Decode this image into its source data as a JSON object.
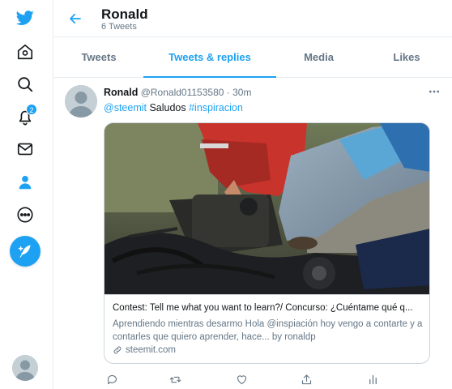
{
  "nav": {
    "notifications_badge": "2",
    "icons": [
      "twitter-logo-icon",
      "home-icon",
      "explore-icon",
      "notifications-icon",
      "messages-icon",
      "profile-icon",
      "more-icon",
      "compose-icon"
    ],
    "accent": "#1da1f2"
  },
  "header": {
    "name": "Ronald",
    "tweets_count": "6 Tweets"
  },
  "tabs": [
    {
      "label": "Tweets"
    },
    {
      "label": "Tweets & replies"
    },
    {
      "label": "Media"
    },
    {
      "label": "Likes"
    }
  ],
  "tweet": {
    "author_name": "Ronald",
    "author_handle": "@Ronald01153580",
    "dot": "·",
    "time": "30m",
    "text_mention": "@steemit",
    "text_word": " Saludos ",
    "text_hashtag": "#inspiracion",
    "card": {
      "title": "Contest: Tell me what you want to learn?/ Concurso: ¿Cuéntame qué q...",
      "description": "Aprendiendo mientras desarmo Hola @inspiación hoy vengo a contarte y a contarles que quiero aprender, hace... by ronaldp",
      "domain": "steemit.com"
    }
  }
}
